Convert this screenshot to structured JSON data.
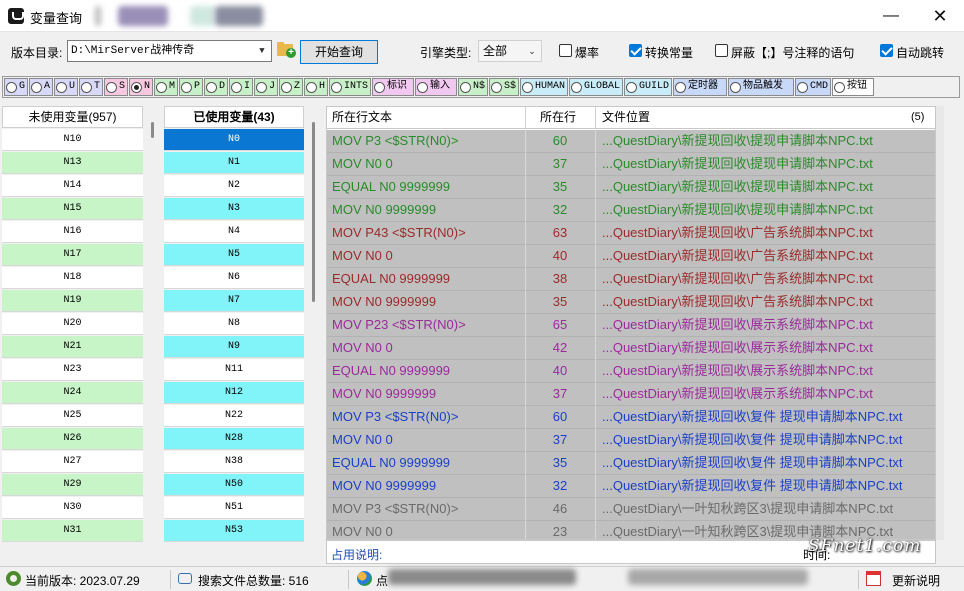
{
  "window": {
    "title": "变量查询",
    "minimize_glyph": "—",
    "close_glyph": "✕"
  },
  "toolbar": {
    "dir_label": "版本目录:",
    "dir_value": "D:\\MirServer战神传奇",
    "start_button": "开始查询",
    "engine_label": "引擎类型:",
    "engine_value": "全部",
    "options": [
      {
        "label": "爆率",
        "checked": false
      },
      {
        "label": "转换常量",
        "checked": true
      },
      {
        "label": "屏蔽【;】号注释的语句",
        "checked": false
      },
      {
        "label": "自动跳转",
        "checked": true
      }
    ]
  },
  "filters": [
    {
      "label": "G",
      "color": "#d8d8f8",
      "selected": false
    },
    {
      "label": "A",
      "color": "#d8d8f8",
      "selected": false
    },
    {
      "label": "U",
      "color": "#d8d8f8",
      "selected": false
    },
    {
      "label": "T",
      "color": "#d8d8f8",
      "selected": false
    },
    {
      "label": "S",
      "color": "#f8c8e0",
      "selected": false
    },
    {
      "label": "N",
      "color": "#f8c8e0",
      "selected": true
    },
    {
      "label": "M",
      "color": "#c8f0c8",
      "selected": false
    },
    {
      "label": "P",
      "color": "#c8f0c8",
      "selected": false
    },
    {
      "label": "D",
      "color": "#c8f0c8",
      "selected": false
    },
    {
      "label": "I",
      "color": "#c8f0c8",
      "selected": false
    },
    {
      "label": "J",
      "color": "#c8f0c8",
      "selected": false
    },
    {
      "label": "Z",
      "color": "#c8f0c8",
      "selected": false
    },
    {
      "label": "H",
      "color": "#c8f0c8",
      "selected": false
    },
    {
      "label": "INTS",
      "color": "#c8f0c8",
      "selected": false
    },
    {
      "label": "标识",
      "color": "#f0c8f0",
      "selected": false
    },
    {
      "label": "输入",
      "color": "#f0c8f0",
      "selected": false
    },
    {
      "label": "N$",
      "color": "#c8f0c8",
      "selected": false
    },
    {
      "label": "S$",
      "color": "#c8f0c8",
      "selected": false
    },
    {
      "label": "HUMAN",
      "color": "#c8ecf8",
      "selected": false
    },
    {
      "label": "GLOBAL",
      "color": "#c8ecf8",
      "selected": false
    },
    {
      "label": "GUILD",
      "color": "#c8ecf8",
      "selected": false
    },
    {
      "label": "定时器",
      "color": "#c8d8f8",
      "selected": false
    },
    {
      "label": "物品触发",
      "color": "#c8d8f8",
      "selected": false
    },
    {
      "label": "CMD",
      "color": "#c8d8f8",
      "selected": false
    },
    {
      "label": "按钮",
      "color": "#ffffff",
      "selected": false
    }
  ],
  "unused": {
    "header": "未使用变量(957)",
    "items": [
      "N10",
      "N13",
      "N14",
      "N15",
      "N16",
      "N17",
      "N18",
      "N19",
      "N20",
      "N21",
      "N23",
      "N24",
      "N25",
      "N26",
      "N27",
      "N29",
      "N30",
      "N31"
    ],
    "highlight": [
      false,
      true,
      false,
      true,
      false,
      true,
      false,
      true,
      false,
      true,
      false,
      true,
      false,
      true,
      false,
      true,
      false,
      true
    ]
  },
  "used": {
    "header": "已使用变量(43)",
    "items": [
      "N0",
      "N1",
      "N2",
      "N3",
      "N4",
      "N5",
      "N6",
      "N7",
      "N8",
      "N9",
      "N11",
      "N12",
      "N22",
      "N28",
      "N38",
      "N50",
      "N51",
      "N53"
    ],
    "selected_index": 0
  },
  "results": {
    "col_text": "所在行文本",
    "col_line": "所在行",
    "col_file": "文件位置",
    "count": "(5)",
    "rows": [
      {
        "text": "MOV P3 <$STR(N0)>",
        "line": "60",
        "file": "...QuestDiary\\新提现回收\\提现申请脚本NPC.txt",
        "color": "#2a8a2a"
      },
      {
        "text": "MOV N0 0",
        "line": "37",
        "file": "...QuestDiary\\新提现回收\\提现申请脚本NPC.txt",
        "color": "#2a8a2a"
      },
      {
        "text": "EQUAL N0 9999999",
        "line": "35",
        "file": "...QuestDiary\\新提现回收\\提现申请脚本NPC.txt",
        "color": "#2a8a2a"
      },
      {
        "text": "MOV N0 9999999",
        "line": "32",
        "file": "...QuestDiary\\新提现回收\\提现申请脚本NPC.txt",
        "color": "#2a8a2a"
      },
      {
        "text": "MOV P43 <$STR(N0)>",
        "line": "63",
        "file": "...QuestDiary\\新提现回收\\广告系统脚本NPC.txt",
        "color": "#9b2a2a"
      },
      {
        "text": "MOV N0 0",
        "line": "40",
        "file": "...QuestDiary\\新提现回收\\广告系统脚本NPC.txt",
        "color": "#9b2a2a"
      },
      {
        "text": "EQUAL N0 9999999",
        "line": "38",
        "file": "...QuestDiary\\新提现回收\\广告系统脚本NPC.txt",
        "color": "#9b2a2a"
      },
      {
        "text": "MOV N0 9999999",
        "line": "35",
        "file": "...QuestDiary\\新提现回收\\广告系统脚本NPC.txt",
        "color": "#9b2a2a"
      },
      {
        "text": "MOV P23 <$STR(N0)>",
        "line": "65",
        "file": "...QuestDiary\\新提现回收\\展示系统脚本NPC.txt",
        "color": "#9a2a9a"
      },
      {
        "text": "MOV N0 0",
        "line": "42",
        "file": "...QuestDiary\\新提现回收\\展示系统脚本NPC.txt",
        "color": "#9a2a9a"
      },
      {
        "text": "EQUAL N0 9999999",
        "line": "40",
        "file": "...QuestDiary\\新提现回收\\展示系统脚本NPC.txt",
        "color": "#9a2a9a"
      },
      {
        "text": "MOV N0 9999999",
        "line": "37",
        "file": "...QuestDiary\\新提现回收\\展示系统脚本NPC.txt",
        "color": "#9a2a9a"
      },
      {
        "text": "MOV P3 <$STR(N0)>",
        "line": "60",
        "file": "...QuestDiary\\新提现回收\\复件 提现申请脚本NPC.txt",
        "color": "#1a3fc8"
      },
      {
        "text": "MOV N0 0",
        "line": "37",
        "file": "...QuestDiary\\新提现回收\\复件 提现申请脚本NPC.txt",
        "color": "#1a3fc8"
      },
      {
        "text": "EQUAL N0 9999999",
        "line": "35",
        "file": "...QuestDiary\\新提现回收\\复件 提现申请脚本NPC.txt",
        "color": "#1a3fc8"
      },
      {
        "text": "MOV N0 9999999",
        "line": "32",
        "file": "...QuestDiary\\新提现回收\\复件 提现申请脚本NPC.txt",
        "color": "#1a3fc8"
      },
      {
        "text": "MOV P3 <$STR(N0)>",
        "line": "46",
        "file": "...QuestDiary\\一叶知秋跨区3\\提现申请脚本NPC.txt",
        "color": "#6a6a6a"
      },
      {
        "text": "MOV N0 0",
        "line": "23",
        "file": "...QuestDiary\\一叶知秋跨区3\\提现申请脚本NPC.txt",
        "color": "#6a6a6a"
      }
    ]
  },
  "usage": {
    "label": "占用说明:",
    "time_label": "时间:"
  },
  "watermark": "SFnet1.com",
  "status": {
    "version_text": "当前版本: 2023.07.29",
    "files_text": "搜索文件总数量: 516",
    "partial_text": "点",
    "update_text": "更新说明"
  }
}
